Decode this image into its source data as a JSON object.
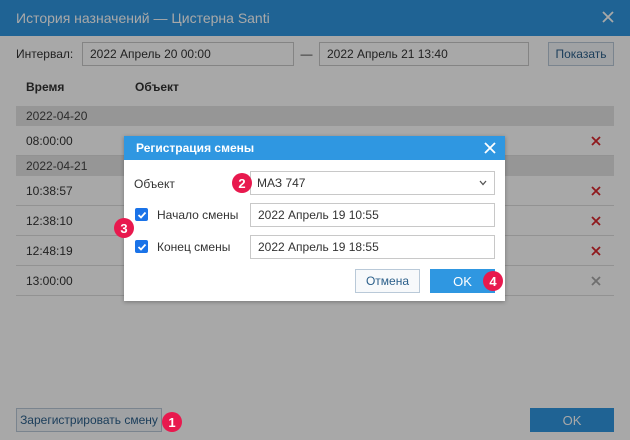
{
  "window": {
    "title": "История назначений — Цистерна Santi",
    "close_icon": "close-icon"
  },
  "interval": {
    "label": "Интервал:",
    "from": "2022 Апрель 20 00:00",
    "separator": "—",
    "to": "2022 Апрель 21 13:40",
    "show_button": "Показать"
  },
  "table": {
    "columns": [
      "Время",
      "Объект"
    ],
    "groups": [
      {
        "date": "2022-04-20",
        "rows": [
          {
            "time": "08:00:00",
            "deletable": true
          }
        ]
      },
      {
        "date": "2022-04-21",
        "rows": [
          {
            "time": "10:38:57",
            "deletable": true
          },
          {
            "time": "12:38:10",
            "deletable": true
          },
          {
            "time": "12:48:19",
            "deletable": true
          },
          {
            "time": "13:00:00",
            "deletable": false
          }
        ]
      }
    ]
  },
  "footer": {
    "register_button": "Зарегистрировать смену",
    "ok_button": "OK"
  },
  "modal": {
    "title": "Регистрация смены",
    "object_label": "Объект",
    "object_value": "МАЗ 747",
    "start_label": "Начало смены",
    "start_checked": true,
    "start_value": "2022 Апрель 19 10:55",
    "end_label": "Конец смены",
    "end_checked": true,
    "end_value": "2022 Апрель 19 18:55",
    "cancel_button": "Отмена",
    "ok_button": "OK"
  },
  "badges": [
    "1",
    "2",
    "3",
    "4"
  ],
  "colors": {
    "accent": "#2f97e1",
    "delete": "#d9262c",
    "badge": "#e8194e",
    "group_bg": "#e4e4e4"
  }
}
